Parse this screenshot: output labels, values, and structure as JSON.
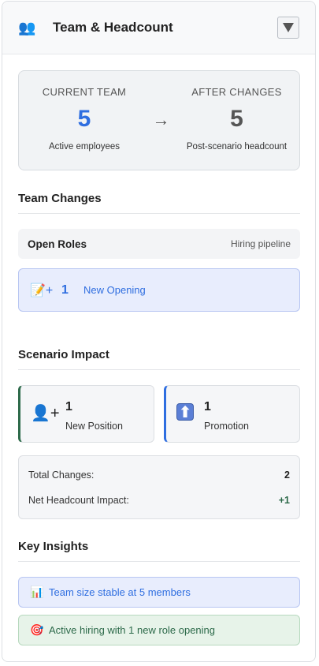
{
  "header": {
    "title": "Team & Headcount",
    "icon": "people-icon"
  },
  "comparison": {
    "current": {
      "label": "CURRENT TEAM",
      "value": "5",
      "sub": "Active employees"
    },
    "arrow": "→",
    "after": {
      "label": "AFTER CHANGES",
      "value": "5",
      "sub": "Post-scenario headcount"
    }
  },
  "team_changes": {
    "title": "Team Changes",
    "open_roles": {
      "label": "Open Roles",
      "tag": "Hiring pipeline"
    },
    "opening": {
      "icon": "📝+",
      "count": "1",
      "label": "New Opening"
    }
  },
  "scenario_impact": {
    "title": "Scenario Impact",
    "cards": [
      {
        "icon": "👤+",
        "value": "1",
        "label": "New Position"
      },
      {
        "icon": "⬆",
        "value": "1",
        "label": "Promotion"
      }
    ],
    "totals": [
      {
        "label": "Total Changes:",
        "value": "2"
      },
      {
        "label": "Net Headcount Impact:",
        "value": "+1"
      }
    ]
  },
  "key_insights": {
    "title": "Key Insights",
    "items": [
      {
        "icon": "📊",
        "text": "Team size stable at 5 members"
      },
      {
        "icon": "🎯",
        "text": "Active hiring with 1 new role opening"
      }
    ]
  },
  "colors": {
    "accent_blue": "#2f6ee0",
    "accent_green": "#2d6a4a"
  }
}
